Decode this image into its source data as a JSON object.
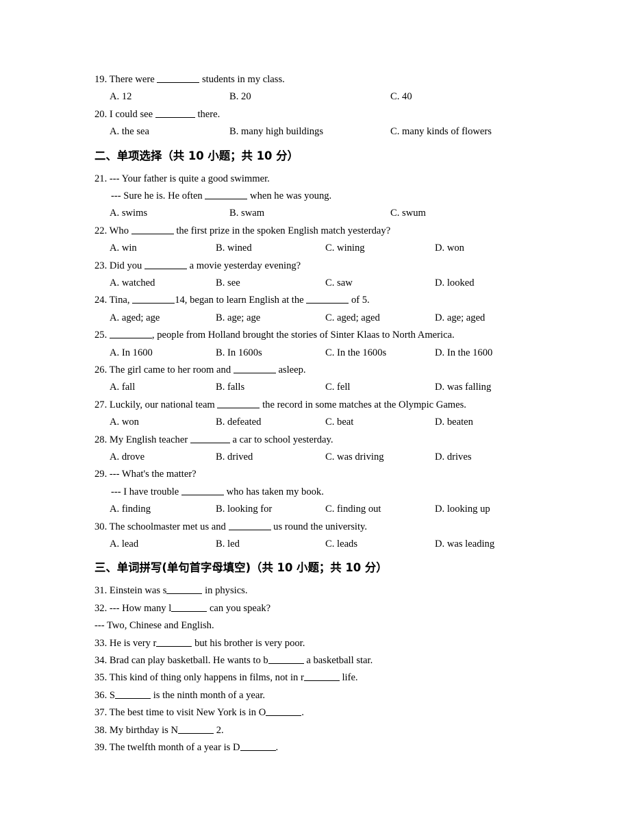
{
  "document": {
    "type": "english-exam-paper",
    "language": "zh-CN / en"
  },
  "continued_questions": [
    {
      "number": "19.",
      "stem_before": "There were",
      "stem_after": "students in my class.",
      "option_count": 3,
      "options": [
        "A. 12",
        "B. 20",
        "C. 40"
      ]
    },
    {
      "number": "20.",
      "stem_before": "I could see",
      "stem_after": "there.",
      "option_count": 3,
      "options": [
        "A. the sea",
        "B. many high buildings",
        "C. many kinds of flowers"
      ]
    }
  ],
  "section_two": {
    "heading": "二、单项选择（共 10 小题；共 10 分）",
    "questions": [
      {
        "number": "21.",
        "line1": "--- Your father is quite a good swimmer.",
        "line2_before": "--- Sure he is. He often",
        "line2_after": "when he was young.",
        "option_count": 3,
        "options": [
          "A. swims",
          "B. swam",
          "C. swum"
        ]
      },
      {
        "number": "22.",
        "stem_before": "Who",
        "stem_after": "the first prize in the spoken English match yesterday?",
        "option_count": 4,
        "options": [
          "A. win",
          "B. wined",
          "C. wining",
          "D. won"
        ]
      },
      {
        "number": "23.",
        "stem_before": "Did you",
        "stem_after": "a movie yesterday evening?",
        "option_count": 4,
        "options": [
          "A. watched",
          "B. see",
          "C. saw",
          "D. looked"
        ]
      },
      {
        "number": "24.",
        "stem_before": "Tina,",
        "stem_mid": "14, began to learn English at the",
        "stem_after": "of 5.",
        "option_count": 4,
        "options": [
          "A. aged; age",
          "B. age; age",
          "C. aged; aged",
          "D. age; aged"
        ]
      },
      {
        "number": "25.",
        "stem_before": "",
        "stem_after": ", people from Holland brought the stories of Sinter Klaas to North America.",
        "option_count": 4,
        "options": [
          "A. In 1600",
          "B. In 1600s",
          "C. In the 1600s",
          "D. In the 1600"
        ]
      },
      {
        "number": "26.",
        "stem_before": "The girl came to her room and",
        "stem_after": "asleep.",
        "option_count": 4,
        "options": [
          "A. fall",
          "B. falls",
          "C. fell",
          "D. was falling"
        ]
      },
      {
        "number": "27.",
        "stem_before": "Luckily, our national team",
        "stem_after": "the record in some matches at the Olympic Games.",
        "option_count": 4,
        "options": [
          "A. won",
          "B. defeated",
          "C. beat",
          "D. beaten"
        ]
      },
      {
        "number": "28.",
        "stem_before": "My English teacher",
        "stem_after": "a car to school yesterday.",
        "option_count": 4,
        "options": [
          "A. drove",
          "B. drived",
          "C. was driving",
          "D. drives"
        ]
      },
      {
        "number": "29.",
        "line1": "--- What's the matter?",
        "line2_before": "--- I have trouble",
        "line2_after": "who has taken my book.",
        "option_count": 4,
        "options": [
          "A. finding",
          "B. looking for",
          "C. finding out",
          "D. looking up"
        ]
      },
      {
        "number": "30.",
        "stem_before": "The schoolmaster met us and",
        "stem_after": "us round the university.",
        "option_count": 4,
        "options": [
          "A. lead",
          "B. led",
          "C. leads",
          "D. was leading"
        ]
      }
    ]
  },
  "section_three": {
    "heading": "三、单词拼写(单句首字母填空)（共 10 小题；共 10 分）",
    "questions": [
      {
        "number": "31.",
        "before": "Einstein was s",
        "after": "in physics."
      },
      {
        "number": "32.",
        "before": "--- How many l",
        "after": "can you speak?",
        "answer_line": "--- Two, Chinese and English."
      },
      {
        "number": "33.",
        "before": "He is very r",
        "after": "but his brother is very poor."
      },
      {
        "number": "34.",
        "before": "Brad can play basketball. He wants to b",
        "after": "a basketball star."
      },
      {
        "number": "35.",
        "before": "This kind of thing only happens in films, not in r",
        "after": "life."
      },
      {
        "number": "36.",
        "before": "S",
        "after": "is the ninth month of a year."
      },
      {
        "number": "37.",
        "before": "The best time to visit New York is in O",
        "after": "."
      },
      {
        "number": "38.",
        "before": "My birthday is N",
        "after": "2."
      },
      {
        "number": "39.",
        "before": "The twelfth month of a year is D",
        "after": "."
      }
    ]
  }
}
